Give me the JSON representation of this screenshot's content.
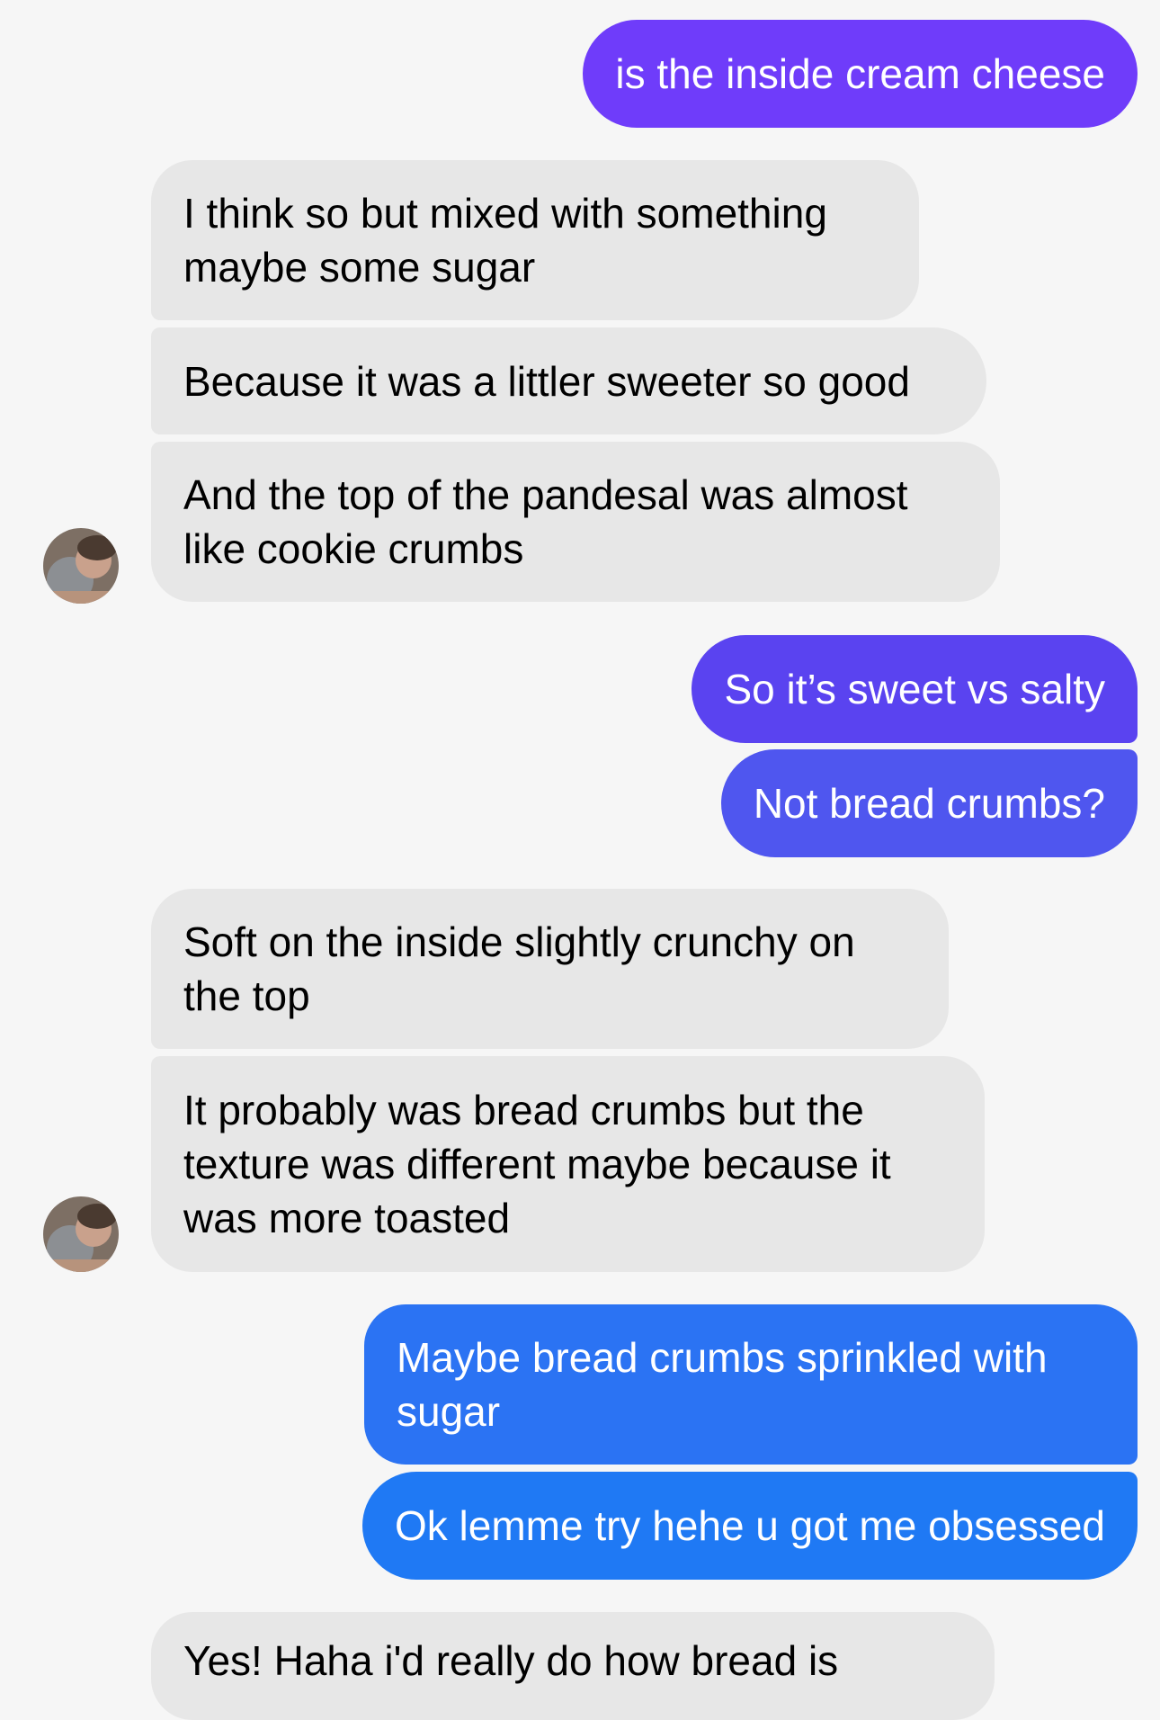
{
  "conversation": {
    "messages": [
      {
        "sender": "me",
        "text": "is the inside cream cheese"
      },
      {
        "sender": "them",
        "text": "I think so but mixed with something maybe some sugar"
      },
      {
        "sender": "them",
        "text": "Because it was a littler sweeter so good"
      },
      {
        "sender": "them",
        "text": "And the top of the pandesal was almost like cookie crumbs"
      },
      {
        "sender": "me",
        "text": "So it’s sweet vs salty"
      },
      {
        "sender": "me",
        "text": "Not bread crumbs?"
      },
      {
        "sender": "them",
        "text": "Soft on the inside slightly crunchy on the top"
      },
      {
        "sender": "them",
        "text": "It probably was bread crumbs but the texture was different maybe because it was more toasted"
      },
      {
        "sender": "me",
        "text": "Maybe bread crumbs sprinkled with sugar"
      },
      {
        "sender": "me",
        "text": "Ok lemme try hehe u got me obsessed"
      }
    ],
    "partially_visible_message_fragment": "Yes! Haha i'd really do how bread is"
  },
  "colors": {
    "background": "#f6f6f6",
    "incoming_bubble": "#e7e7e7",
    "outgoing_gradient": [
      "#6f3cfa",
      "#5a43f0",
      "#4f56ef",
      "#3b6cf1",
      "#2b73f3",
      "#1f79f4"
    ]
  },
  "icons": {
    "contact_avatar": "contact-avatar-photo"
  }
}
